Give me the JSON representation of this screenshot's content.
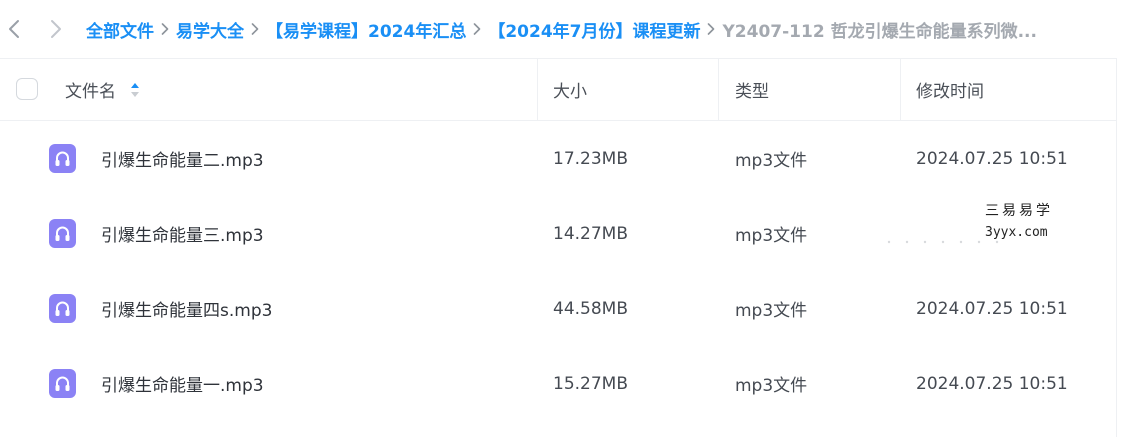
{
  "breadcrumb": {
    "items": [
      {
        "label": "全部文件"
      },
      {
        "label": "易学大全"
      },
      {
        "label": "【易学课程】2024年汇总"
      },
      {
        "label": "【2024年7月份】课程更新"
      },
      {
        "label": "Y2407-112 哲龙引爆生命能量系列微..."
      }
    ]
  },
  "table": {
    "columns": {
      "name": "文件名",
      "size": "大小",
      "type": "类型",
      "modified": "修改时间"
    },
    "rows": [
      {
        "name": "引爆生命能量二.mp3",
        "size": "17.23MB",
        "type": "mp3文件",
        "modified": "2024.07.25 10:51"
      },
      {
        "name": "引爆生命能量三.mp3",
        "size": "14.27MB",
        "type": "mp3文件",
        "modified": ""
      },
      {
        "name": "引爆生命能量四s.mp3",
        "size": "44.58MB",
        "type": "mp3文件",
        "modified": "2024.07.25 10:51"
      },
      {
        "name": "引爆生命能量一.mp3",
        "size": "15.27MB",
        "type": "mp3文件",
        "modified": "2024.07.25 10:51"
      }
    ]
  },
  "watermark": {
    "line1": "三易易学",
    "line2": "3yyx.com"
  },
  "colors": {
    "accent": "#1a8ff5",
    "file_icon": "#8b82f5"
  }
}
